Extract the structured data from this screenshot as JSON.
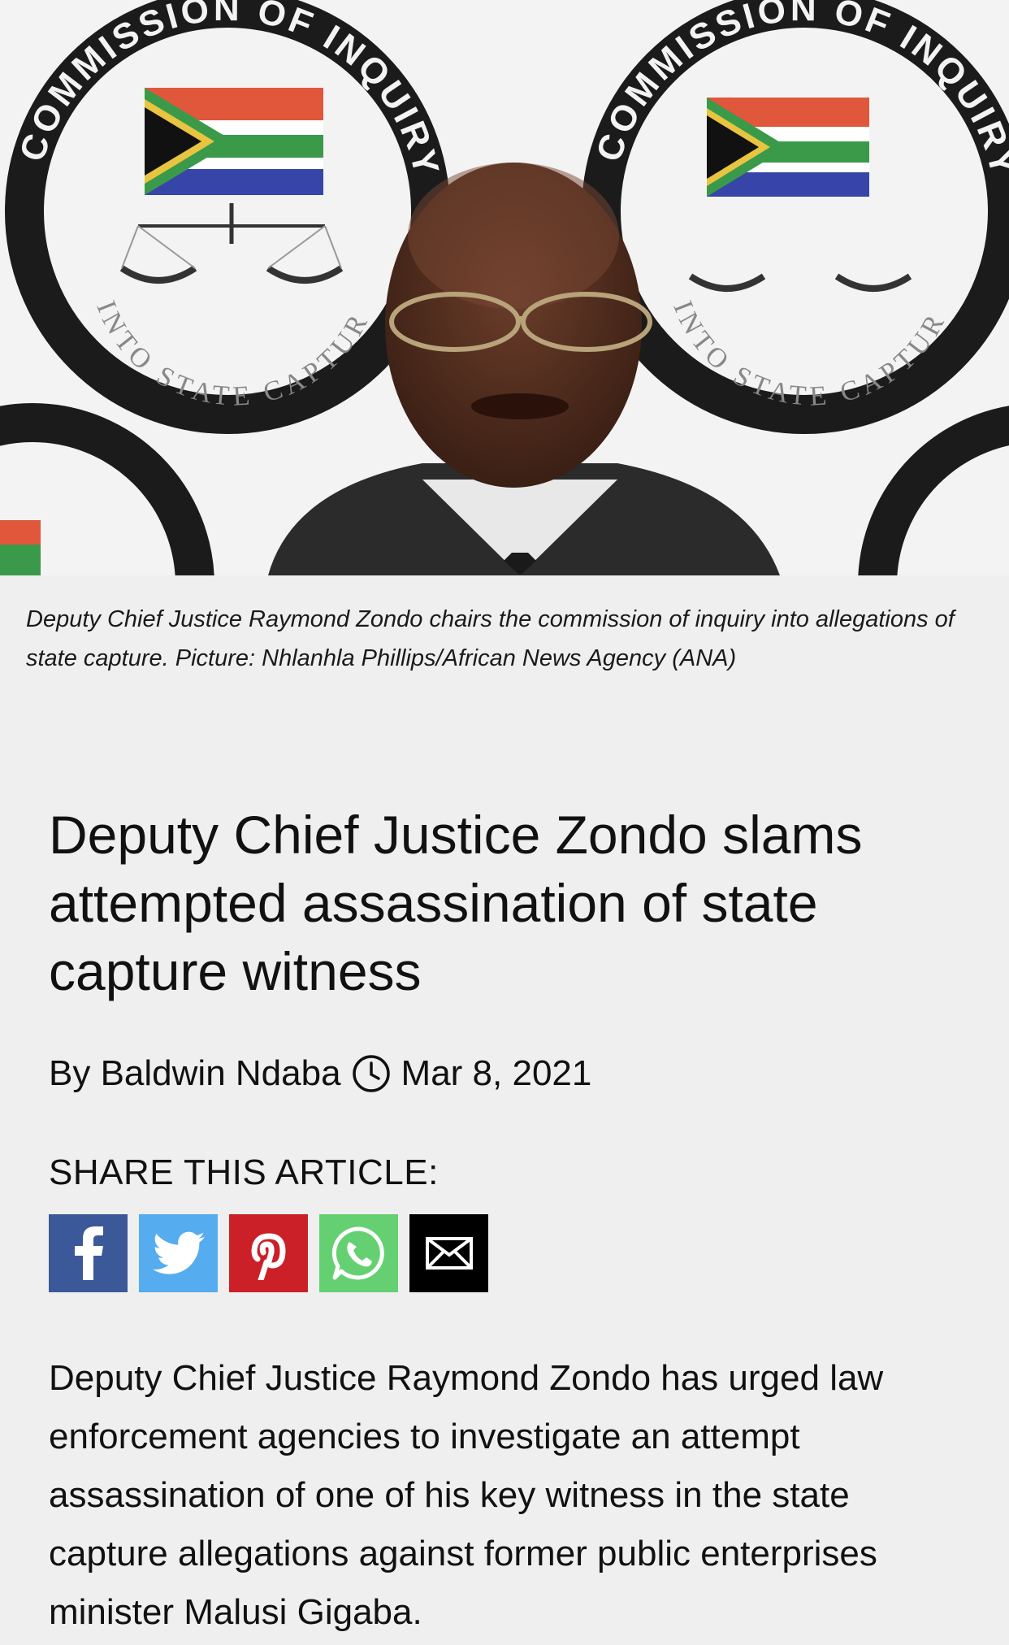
{
  "hero_image": {
    "seal_top_text": "COMMISSION OF INQUIRY",
    "seal_bottom_text": "INTO STATE CAPTURE"
  },
  "caption": "Deputy Chief Justice Raymond Zondo chairs the commission of inquiry into allegations of state capture. Picture: Nhlanhla Phillips/African News Agency (ANA)",
  "headline": "Deputy Chief Justice Zondo slams attempted assassination of state capture witness",
  "byline": {
    "author": "By Baldwin Ndaba",
    "date": "Mar 8, 2021",
    "icon": "clock-icon"
  },
  "share": {
    "label": "SHARE THIS ARTICLE:",
    "buttons": [
      {
        "name": "facebook",
        "icon": "facebook-icon",
        "color": "#3b5998"
      },
      {
        "name": "twitter",
        "icon": "twitter-icon",
        "color": "#55acee"
      },
      {
        "name": "pinterest",
        "icon": "pinterest-icon",
        "color": "#cb2027"
      },
      {
        "name": "whatsapp",
        "icon": "whatsapp-icon",
        "color": "#65d072"
      },
      {
        "name": "email",
        "icon": "email-icon",
        "color": "#000000"
      }
    ]
  },
  "body": "Deputy Chief Justice Raymond Zondo has urged law enforcement agencies to investigate an attempt assassination of one of his key witness in the state capture allegations against former public enterprises minister Malusi Gigaba."
}
